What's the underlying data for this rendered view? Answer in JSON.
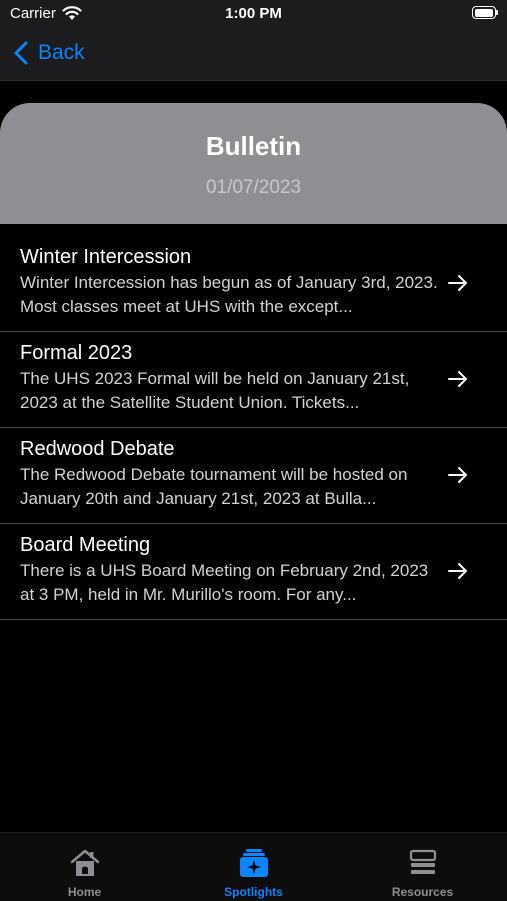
{
  "status_bar": {
    "carrier": "Carrier",
    "time": "1:00 PM"
  },
  "nav": {
    "back_label": "Back"
  },
  "header": {
    "title": "Bulletin",
    "date": "01/07/2023"
  },
  "bulletins": [
    {
      "title": "Winter Intercession",
      "body": "Winter Intercession has begun as of January 3rd, 2023. Most classes meet at UHS with the except..."
    },
    {
      "title": "Formal 2023",
      "body": "The UHS 2023 Formal will be held on January 21st, 2023 at the Satellite Student Union. Tickets..."
    },
    {
      "title": "Redwood Debate",
      "body": "The Redwood Debate tournament will be hosted on January 20th and January 21st, 2023 at Bulla..."
    },
    {
      "title": "Board Meeting",
      "body": "There is a UHS Board Meeting on February 2nd, 2023 at 3 PM, held in Mr. Murillo's room. For any..."
    }
  ],
  "tabs": [
    {
      "label": "Home",
      "icon": "home-icon",
      "active": false
    },
    {
      "label": "Spotlights",
      "icon": "spotlights-icon",
      "active": true
    },
    {
      "label": "Resources",
      "icon": "resources-icon",
      "active": false
    }
  ],
  "colors": {
    "accent": "#0a84ff",
    "inactive": "#8e8e93",
    "header_bg": "#8e8e93",
    "background": "#000000"
  }
}
